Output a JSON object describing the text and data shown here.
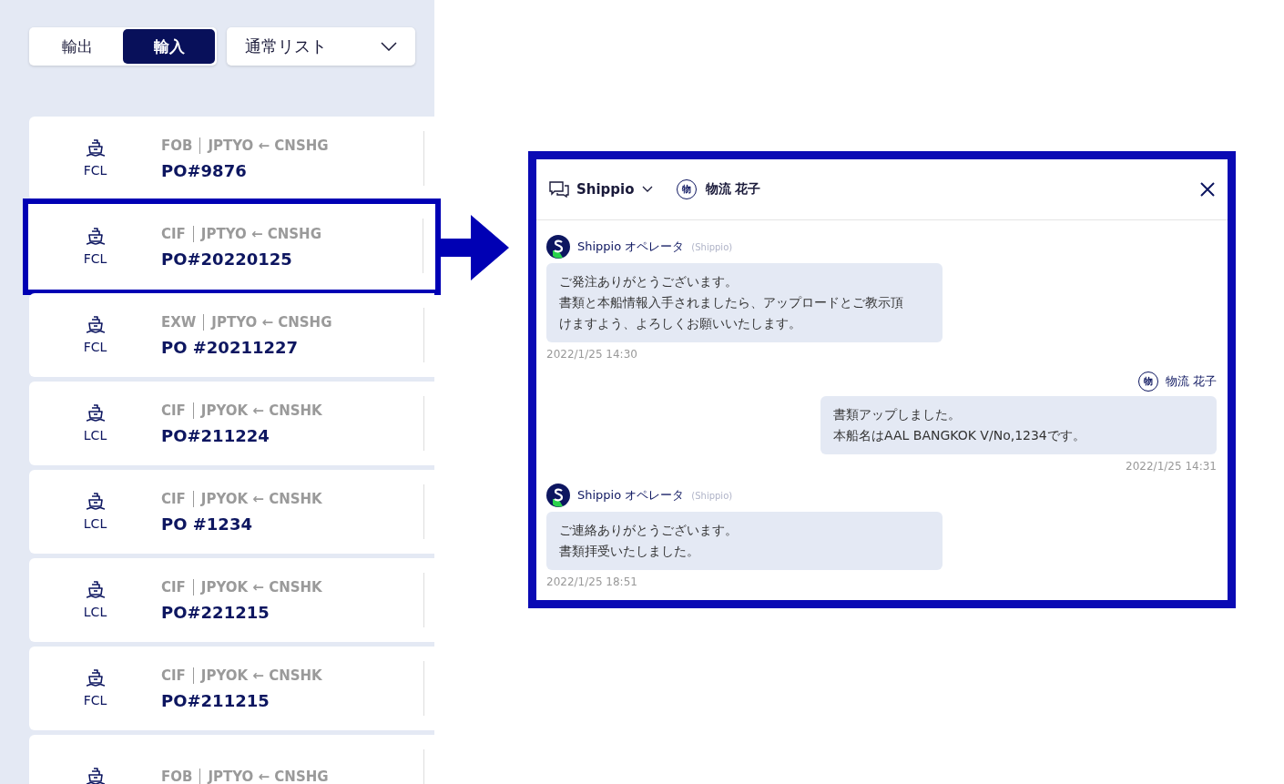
{
  "list_panel": {
    "mode_tabs": [
      {
        "label": "輸出",
        "selected": false
      },
      {
        "label": "輸入",
        "selected": true
      }
    ],
    "list_filter": {
      "value": "通常リスト"
    },
    "shipments": [
      {
        "mode": "FCL",
        "incoterm": "FOB",
        "route": "JPTYO ← CNSHG",
        "po_number": "PO#9876",
        "selected": false
      },
      {
        "mode": "FCL",
        "incoterm": "CIF",
        "route": "JPTYO ← CNSHG",
        "po_number": "PO#20220125",
        "selected": true
      },
      {
        "mode": "FCL",
        "incoterm": "EXW",
        "route": "JPTYO ← CNSHG",
        "po_number": "PO #20211227",
        "selected": false
      },
      {
        "mode": "LCL",
        "incoterm": "CIF",
        "route": "JPYOK ← CNSHK",
        "po_number": "PO#211224",
        "selected": false
      },
      {
        "mode": "LCL",
        "incoterm": "CIF",
        "route": "JPYOK ← CNSHK",
        "po_number": "PO #1234",
        "selected": false
      },
      {
        "mode": "LCL",
        "incoterm": "CIF",
        "route": "JPYOK ← CNSHK",
        "po_number": "PO#221215",
        "selected": false
      },
      {
        "mode": "FCL",
        "incoterm": "CIF",
        "route": "JPYOK ← CNSHK",
        "po_number": "PO#211215",
        "selected": false
      },
      {
        "incoterm": "FOB",
        "route": "JPTYO ← CNSHG",
        "selected": false
      }
    ]
  },
  "chat": {
    "channel": "Shippio",
    "participant": {
      "initial": "物",
      "name": "物流 花子"
    },
    "messages": [
      {
        "kind": "incoming",
        "sender": "Shippio オペレータ",
        "organization": "(Shippio)",
        "lines": [
          "ご発注ありがとうございます。",
          "書類と本船情報入手されましたら、アップロードとご教示頂けますよう、よろしくお願いいたします。"
        ],
        "time": "2022/1/25 14:30"
      },
      {
        "kind": "outgoing",
        "initial": "物",
        "sender": "物流 花子",
        "lines": [
          "書類アップしました。",
          "本船名はAAL BANGKOK V/No,1234です。"
        ],
        "time": "2022/1/25 14:31"
      },
      {
        "kind": "incoming",
        "sender": "Shippio オペレータ",
        "organization": "(Shippio)",
        "lines": [
          "ご連絡ありがとうございます。",
          "書類拝受いたしました。"
        ],
        "time": "2022/1/25 18:51"
      }
    ]
  }
}
